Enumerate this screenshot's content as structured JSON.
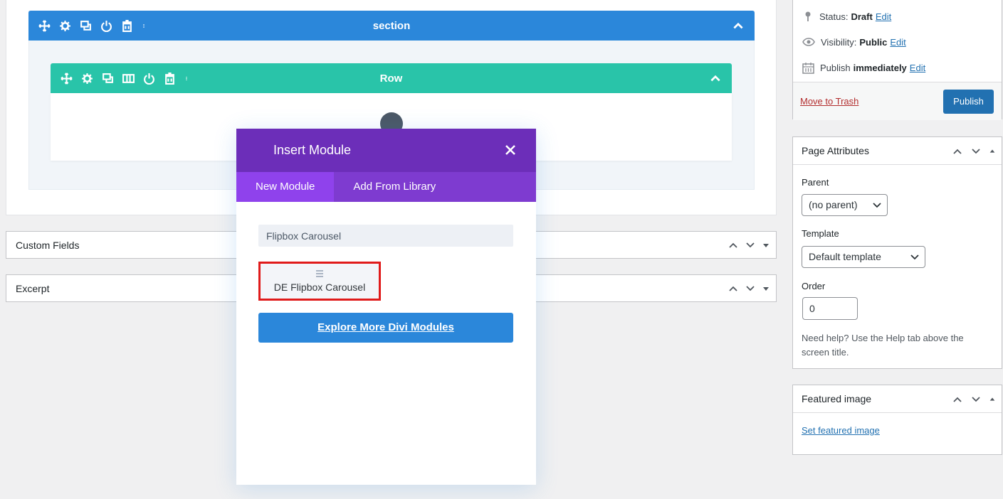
{
  "builder": {
    "section_title": "section",
    "row_title": "Row"
  },
  "metaboxes": {
    "custom_fields": "Custom Fields",
    "excerpt": "Excerpt"
  },
  "modal": {
    "title": "Insert Module",
    "tabs": [
      "New Module",
      "Add From Library"
    ],
    "search_value": "Flipbox Carousel",
    "module_label": "DE Flipbox Carousel",
    "explore_label": "Explore More Divi Modules"
  },
  "publish": {
    "status_label": "Status:",
    "status_value": "Draft",
    "visibility_label": "Visibility:",
    "visibility_value": "Public",
    "publish_label": "Publish",
    "publish_value": "immediately",
    "edit_label": "Edit",
    "trash_label": "Move to Trash",
    "publish_button": "Publish"
  },
  "page_attributes": {
    "title": "Page Attributes",
    "parent_label": "Parent",
    "parent_value": "(no parent)",
    "template_label": "Template",
    "template_value": "Default template",
    "order_label": "Order",
    "order_value": "0",
    "help_text": "Need help? Use the Help tab above the screen title."
  },
  "featured_image": {
    "title": "Featured image",
    "link": "Set featured image"
  },
  "colors": {
    "section_blue": "#2b87da",
    "row_teal": "#29c4a9",
    "modal_purple": "#6c2eb9",
    "tab_purple": "#7e3bd0",
    "highlight_red": "#e01b1b",
    "wp_blue": "#2271b1"
  }
}
